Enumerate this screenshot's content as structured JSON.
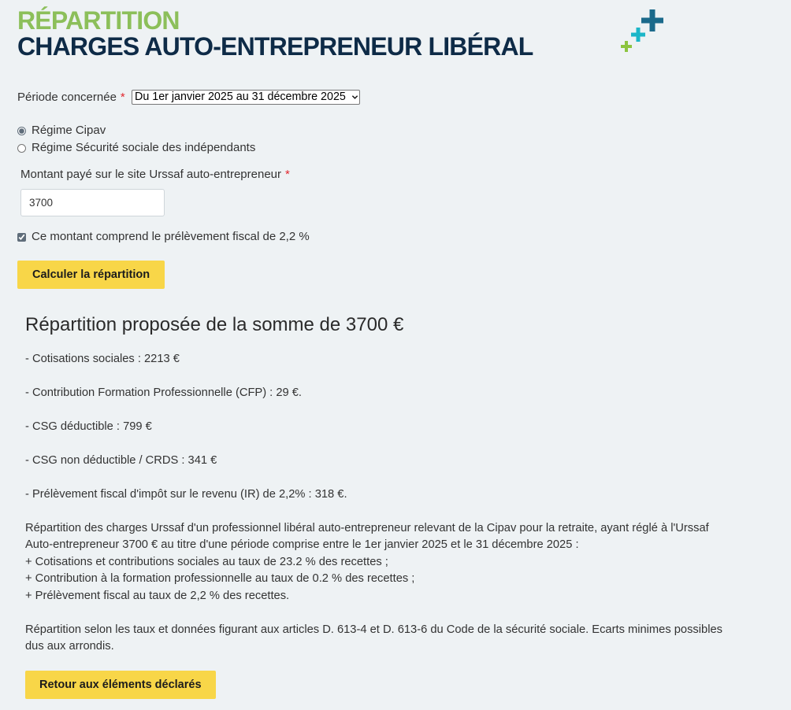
{
  "header": {
    "title_line1": "RÉPARTITION",
    "title_line2": "CHARGES AUTO-ENTREPRENEUR LIBÉRAL"
  },
  "icons": {
    "logo": "plus-crosses-logo-icon",
    "select_arrow": "chevron-down-icon"
  },
  "colors": {
    "background": "#eef2f4",
    "title_green": "#8cbf5a",
    "title_navy": "#0e2b47",
    "text": "#333333",
    "required_red": "#e1262d",
    "button_yellow": "#f8d648",
    "control_accent": "#5f6d7a",
    "logo_teal": "#1b6a8b",
    "logo_cyan": "#1cb6c8",
    "logo_green": "#8cc43f"
  },
  "form": {
    "period": {
      "label": "Période concernée",
      "required_mark": "*",
      "selected_value": "Du 1er janvier 2025 au 31 décembre 2025"
    },
    "regime": {
      "options": [
        {
          "label": "Régime Cipav",
          "checked": true
        },
        {
          "label": "Régime Sécurité sociale des indépendants",
          "checked": false
        }
      ]
    },
    "amount": {
      "label": "Montant payé sur le site Urssaf auto-entrepreneur",
      "required_mark": "*",
      "value": "3700"
    },
    "includes_tax": {
      "label": "Ce montant comprend le prélèvement fiscal de 2,2 %",
      "checked": true
    },
    "submit_label": "Calculer la répartition"
  },
  "result": {
    "heading": "Répartition proposée de la somme de 3700 €",
    "lines": [
      "- Cotisations sociales : 2213 €",
      "- Contribution Formation Professionnelle (CFP) : 29 €.",
      "- CSG déductible : 799 €",
      "- CSG non déductible / CRDS : 341 €",
      "- Prélèvement fiscal d'impôt sur le revenu (IR) de 2,2% : 318 €."
    ],
    "summary_intro": "Répartition des charges Urssaf d'un professionnel libéral auto-entrepreneur relevant de la Cipav pour la retraite, ayant réglé à l'Urssaf Auto-entrepreneur 3700 € au titre d'une période comprise entre le 1er janvier 2025 et le 31 décembre 2025 :",
    "summary_items": [
      "+ Cotisations et contributions sociales au taux de 23.2 % des recettes ;",
      "+ Contribution à la formation professionnelle au taux de 0.2 % des recettes ;",
      "+ Prélèvement fiscal au taux de 2,2 % des recettes."
    ],
    "note": "Répartition selon les taux et données figurant aux articles D. 613-4 et D. 613-6 du Code de la sécurité sociale. Ecarts minimes possibles dus aux arrondis.",
    "back_label": "Retour aux éléments déclarés"
  }
}
